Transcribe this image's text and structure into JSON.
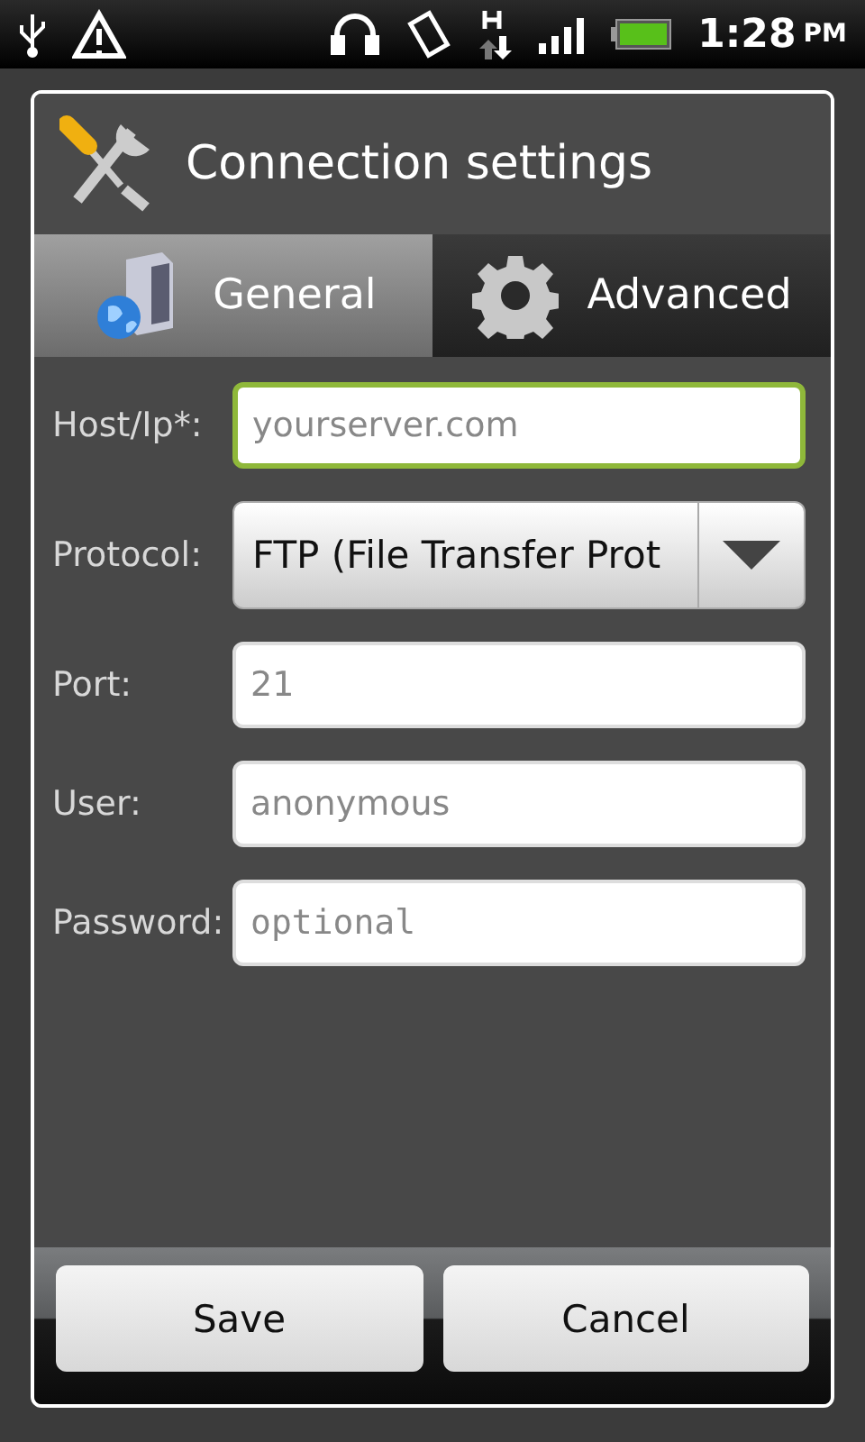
{
  "status_bar": {
    "time": "1:28",
    "ampm": "PM"
  },
  "dialog": {
    "title": "Connection settings",
    "tabs": [
      {
        "label": "General",
        "selected": true
      },
      {
        "label": "Advanced",
        "selected": false
      }
    ],
    "fields": [
      {
        "label": "Host/Ip*:",
        "kind": "text",
        "placeholder": "yourserver.com",
        "focused": true
      },
      {
        "label": "Protocol:",
        "kind": "spinner",
        "value": "FTP (File Transfer Prot",
        "focused": false
      },
      {
        "label": "Port:",
        "kind": "text",
        "placeholder": "21",
        "focused": false
      },
      {
        "label": "User:",
        "kind": "text",
        "placeholder": "anonymous",
        "focused": false
      },
      {
        "label": "Password:",
        "kind": "password",
        "placeholder": "optional",
        "focused": false
      }
    ],
    "buttons": [
      "Save",
      "Cancel"
    ]
  }
}
